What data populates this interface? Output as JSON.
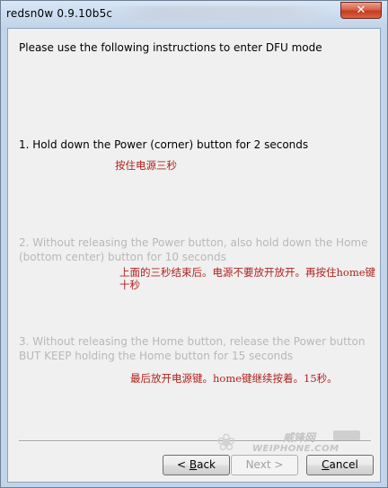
{
  "window": {
    "title": "redsn0w 0.9.10b5c",
    "close_label": "✕"
  },
  "content": {
    "intro": "Please use the following instructions to enter DFU mode",
    "step1": "1. Hold down the Power (corner) button for 2 seconds",
    "step1_cn": "按住电源三秒",
    "step2_line1": "2. Without releasing the Power button, also hold down the Home",
    "step2_line2": "(bottom center) button for 10 seconds",
    "step2_cn_line1": "上面的三秒结束后。电源不要放开放开。再按住home键",
    "step2_cn_line2": "十秒",
    "step3_line1": "3. Without releasing the Home button, release the Power button",
    "step3_line2": "BUT KEEP holding the Home button for 15 seconds",
    "step3_cn": "最后放开电源键。home键继续按着。15秒。"
  },
  "watermark": {
    "cn": "威锋网",
    "en": "WEIPHONE.COM"
  },
  "buttons": {
    "back_prefix": "< ",
    "back_mnemonic": "B",
    "back_rest": "ack",
    "next": "Next >",
    "cancel_mnemonic": "C",
    "cancel_rest": "ancel"
  },
  "colors": {
    "annotation": "#b0201c",
    "disabled_text": "#b8b8b8"
  }
}
